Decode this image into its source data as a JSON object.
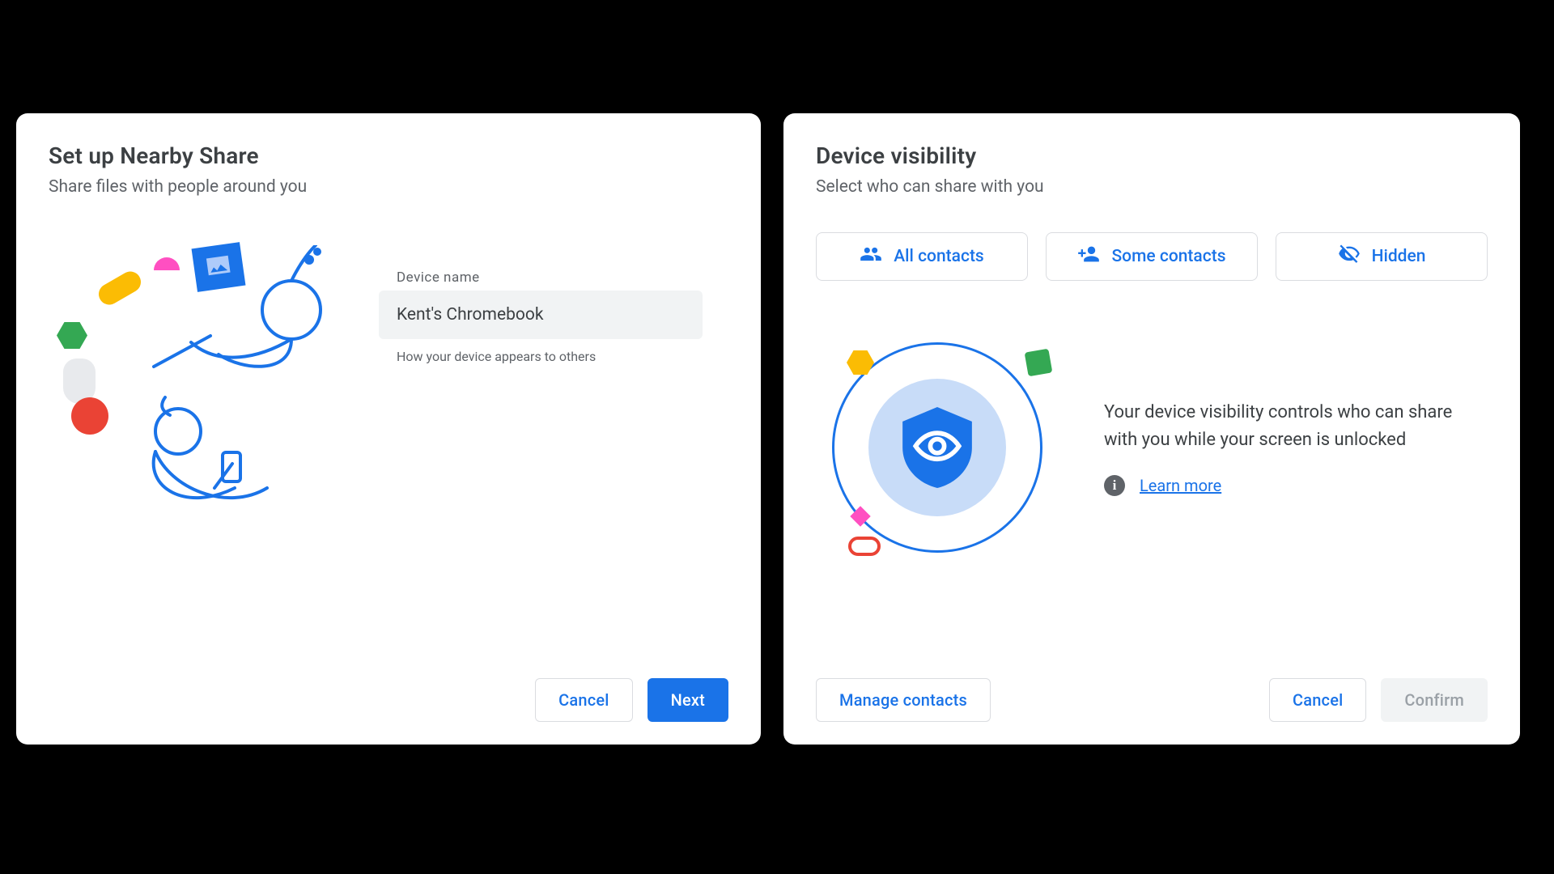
{
  "setup": {
    "title": "Set up Nearby Share",
    "subtitle": "Share files with people around you",
    "device_name_label": "Device name",
    "device_name_value": "Kent's Chromebook",
    "device_name_help": "How your device appears to others",
    "cancel_label": "Cancel",
    "next_label": "Next"
  },
  "visibility": {
    "title": "Device visibility",
    "subtitle": "Select who can share with you",
    "options": [
      {
        "id": "all",
        "label": "All contacts"
      },
      {
        "id": "some",
        "label": "Some contacts"
      },
      {
        "id": "hidden",
        "label": "Hidden"
      }
    ],
    "description": "Your device visibility controls who can share with you while your screen is unlocked",
    "learn_more_label": "Learn more",
    "manage_contacts_label": "Manage contacts",
    "cancel_label": "Cancel",
    "confirm_label": "Confirm"
  }
}
